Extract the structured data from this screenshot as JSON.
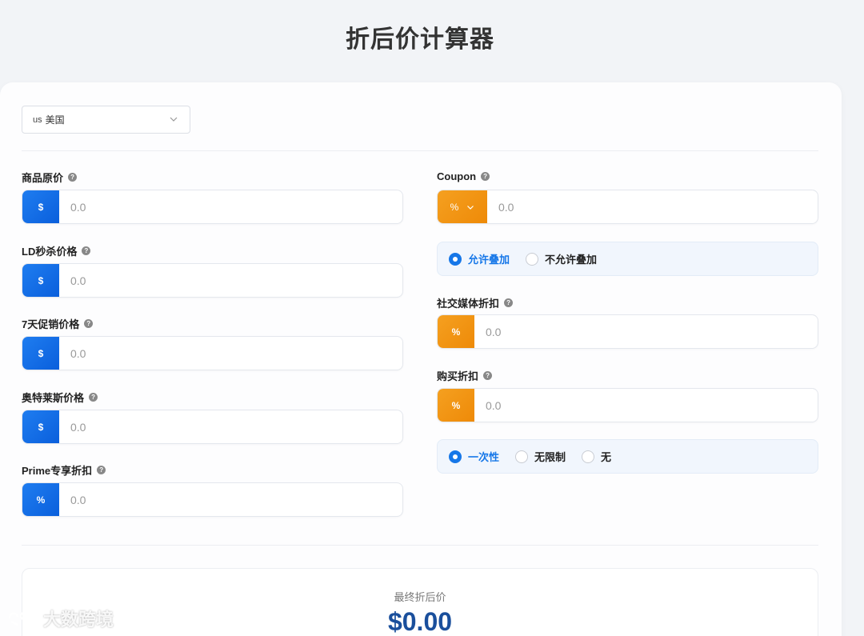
{
  "page": {
    "title": "折后价计算器"
  },
  "country": {
    "flag": "us",
    "name": "美国"
  },
  "fields": {
    "original_price": {
      "label": "商品原价",
      "addon": "$",
      "placeholder": "0.0"
    },
    "ld_price": {
      "label": "LD秒杀价格",
      "addon": "$",
      "placeholder": "0.0"
    },
    "seven_day_price": {
      "label": "7天促销价格",
      "addon": "$",
      "placeholder": "0.0"
    },
    "outlet_price": {
      "label": "奥特莱斯价格",
      "addon": "$",
      "placeholder": "0.0"
    },
    "prime_discount": {
      "label": "Prime专享折扣",
      "addon": "%",
      "placeholder": "0.0"
    },
    "coupon": {
      "label": "Coupon",
      "addon": "%",
      "placeholder": "0.0"
    },
    "social_discount": {
      "label": "社交媒体折扣",
      "addon": "%",
      "placeholder": "0.0"
    },
    "purchase_discount": {
      "label": "购买折扣",
      "addon": "%",
      "placeholder": "0.0"
    }
  },
  "stacking": {
    "options": [
      "允许叠加",
      "不允许叠加"
    ],
    "selected": "允许叠加"
  },
  "usage": {
    "options": [
      "一次性",
      "无限制",
      "无"
    ],
    "selected": "一次性"
  },
  "result": {
    "label": "最终折后价",
    "value": "$0.00"
  },
  "watermark": {
    "text": "大数跨境"
  },
  "colors": {
    "blue": "#1677e8",
    "orange": "#f5a020",
    "result": "#1a4f9c"
  },
  "icons": {
    "help": "question-circle-icon",
    "dropdown": "chevron-down-icon"
  }
}
